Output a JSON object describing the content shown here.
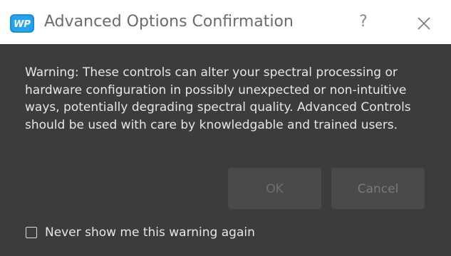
{
  "window": {
    "title": "Advanced Options Confirmation",
    "help_label": "?",
    "logo_text": "WP",
    "logo_icon": "wasatch-photonics-logo-icon",
    "close_icon": "close-icon"
  },
  "message": {
    "text": "Warning: These controls can alter your spectral processing or hardware configuration in possibly unexpected or non-intuitive ways, potentially degrading spectral quality. Advanced Controls should be used with care by knowledgable and trained users."
  },
  "buttons": {
    "ok_label": "OK",
    "cancel_label": "Cancel"
  },
  "checkbox": {
    "label": "Never show me this warning again",
    "checked": false
  },
  "colors": {
    "dialog_bg": "#3c3c3c",
    "titlebar_bg": "#ffffff",
    "button_bg": "#4a4a4a",
    "logo_blue": "#1b8fd6"
  }
}
